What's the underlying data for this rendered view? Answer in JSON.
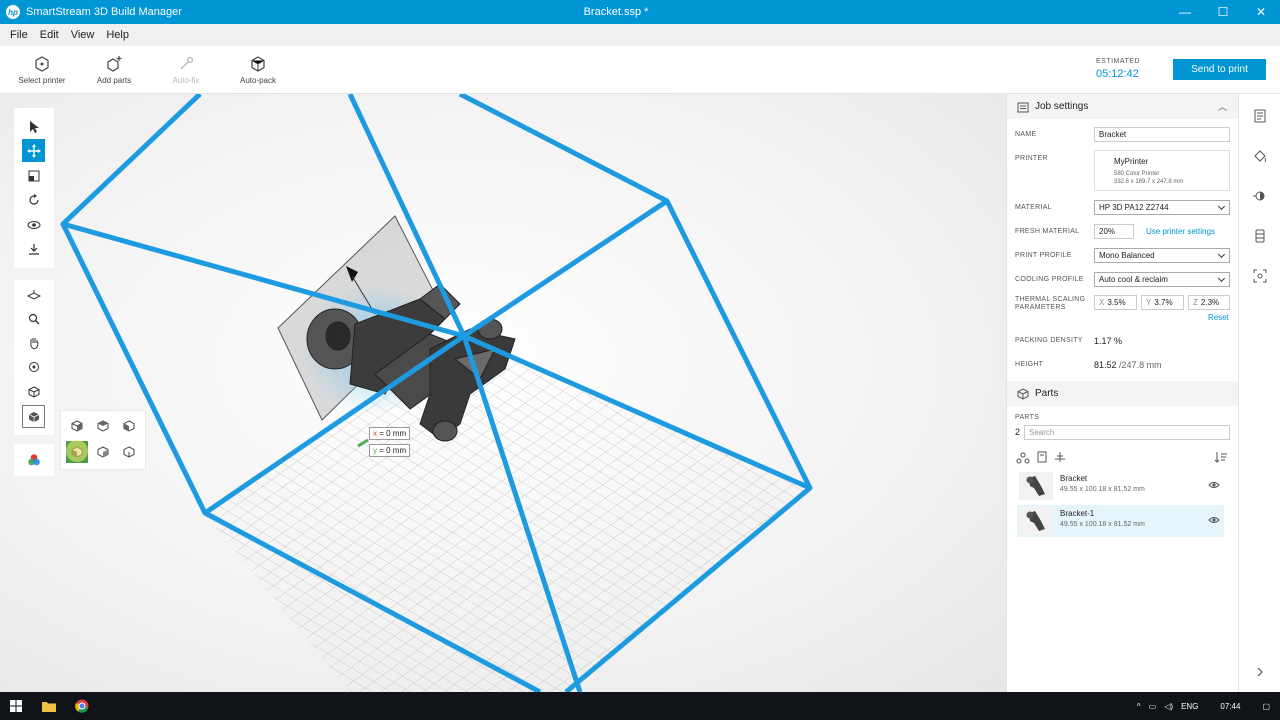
{
  "window": {
    "app_title": "SmartStream 3D Build Manager",
    "doc_title": "Bracket.ssp *",
    "logo_text": "hp",
    "minimize": "—",
    "maximize": "☐",
    "close": "✕"
  },
  "menu": [
    "File",
    "Edit",
    "View",
    "Help"
  ],
  "toolbar": {
    "select_printer": "Select printer",
    "add_parts": "Add parts",
    "auto_fix": "Auto-fix",
    "auto_pack": "Auto-pack",
    "estimated_label": "ESTIMATED",
    "estimated_time": "05:12:42",
    "send_to_print": "Send to print"
  },
  "viewport": {
    "x_tag": "= 0 mm",
    "y_tag": "= 0 mm",
    "box_color": "#1e9be0"
  },
  "job_settings": {
    "title": "Job settings",
    "name_label": "NAME",
    "name_value": "Bracket",
    "printer_label": "PRINTER",
    "printer_name": "MyPrinter",
    "printer_model": "580 Color Printer",
    "printer_dims": "332.6 x 189.7 x 247.8 mm",
    "material_label": "MATERIAL",
    "material_value": "HP 3D PA12 Z2744",
    "fresh_label": "FRESH MATERIAL",
    "fresh_value": "20%",
    "use_printer_settings": "Use printer settings",
    "profile_label": "PRINT PROFILE",
    "profile_value": "Mono Balanced",
    "cooling_label": "COOLING PROFILE",
    "cooling_value": "Auto cool & reclaim",
    "thermal_label_1": "THERMAL SCALING",
    "thermal_label_2": "PARAMETERS",
    "x_label": "X",
    "x_value": "3.5%",
    "y_label": "Y",
    "y_value": "3.7%",
    "z_label": "Z",
    "z_value": "2.3%",
    "reset": "Reset",
    "density_label": "PACKING DENSITY",
    "density_value": "1.17 %",
    "height_label": "HEIGHT",
    "height_value": "81.52",
    "height_max": "/247.8 mm"
  },
  "parts": {
    "title": "Parts",
    "label": "PARTS",
    "count": "2",
    "search_placeholder": "Search",
    "items": [
      {
        "name": "Bracket",
        "dims": "49.55 x 100.18 x 81.52 mm"
      },
      {
        "name": "Bracket-1",
        "dims": "49.55 x 100.18 x 81.52 mm"
      }
    ]
  },
  "taskbar": {
    "lang": "ENG",
    "time": "07:44"
  }
}
